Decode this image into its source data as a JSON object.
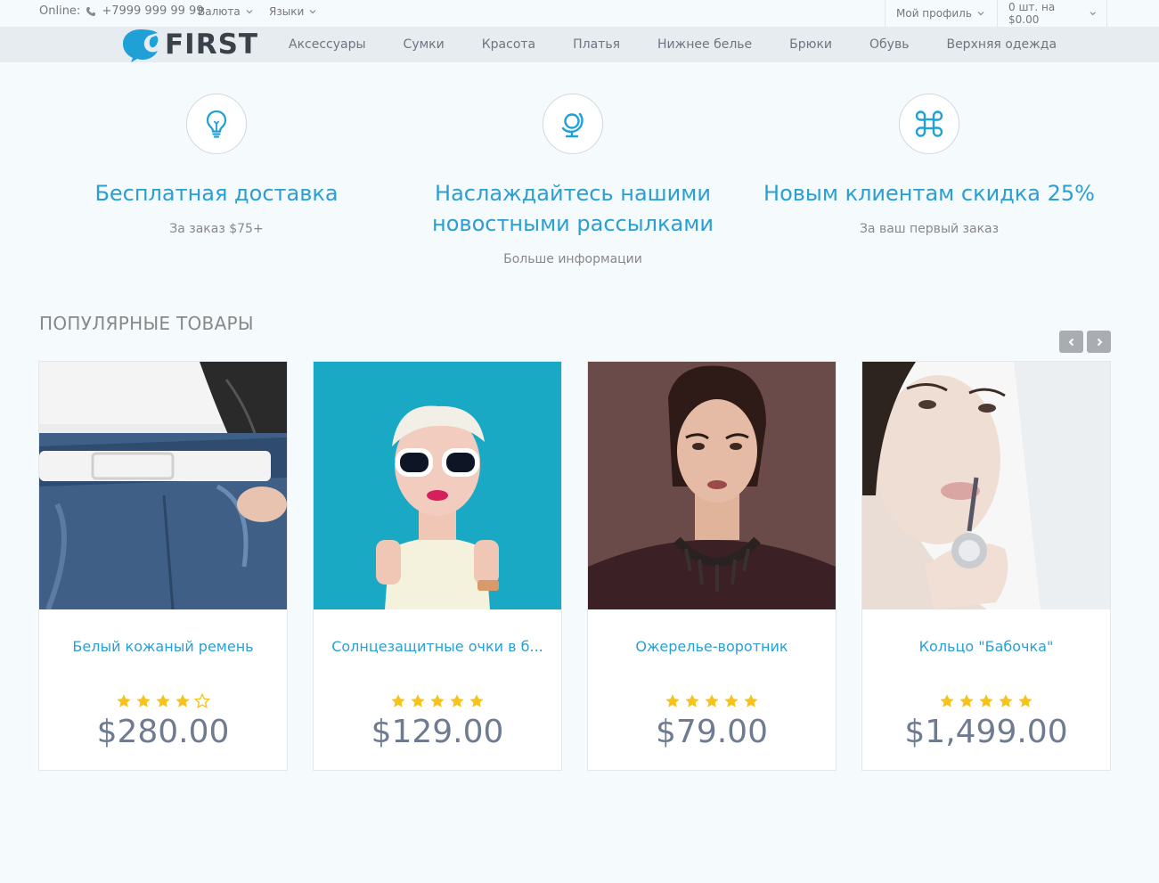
{
  "topbar": {
    "online_label": "Online:",
    "phone": "+7999 999 99 99",
    "currency_label": "Валюта",
    "languages_label": "Языки",
    "profile_label": "Мой профиль",
    "cart_label": "0 шт. на $0.00"
  },
  "brand": {
    "logo_text": "FIRST",
    "logo_color": "#1fa0d6"
  },
  "nav": {
    "items": [
      "Аксессуары",
      "Сумки",
      "Красота",
      "Платья",
      "Нижнее белье",
      "Брюки",
      "Обувь",
      "Верхняя одежда"
    ]
  },
  "features": [
    {
      "icon": "lightbulb-icon",
      "title": "Бесплатная доставка",
      "subtitle": "За заказ $75+"
    },
    {
      "icon": "globe-icon",
      "title": "Наслаждайтесь нашими новостными рассылками",
      "subtitle": "Больше информации"
    },
    {
      "icon": "command-icon",
      "title": "Новым клиентам скидка 25%",
      "subtitle": "За ваш первый заказ"
    }
  ],
  "popular": {
    "title": "ПОПУЛЯРНЫЕ ТОВАРЫ",
    "products": [
      {
        "name": "Белый кожаный ремень",
        "rating": 4,
        "max_rating": 5,
        "price": "$280.00"
      },
      {
        "name": "Солнцезащитные очки в б...",
        "rating": 5,
        "max_rating": 5,
        "price": "$129.00"
      },
      {
        "name": "Ожерелье-воротник",
        "rating": 5,
        "max_rating": 5,
        "price": "$79.00"
      },
      {
        "name": "Кольцо \"Бабочка\"",
        "rating": 5,
        "max_rating": 5,
        "price": "$1,499.00"
      }
    ]
  },
  "colors": {
    "accent": "#2b9fd1",
    "star": "#f6c21c",
    "price": "#6e7b91"
  }
}
